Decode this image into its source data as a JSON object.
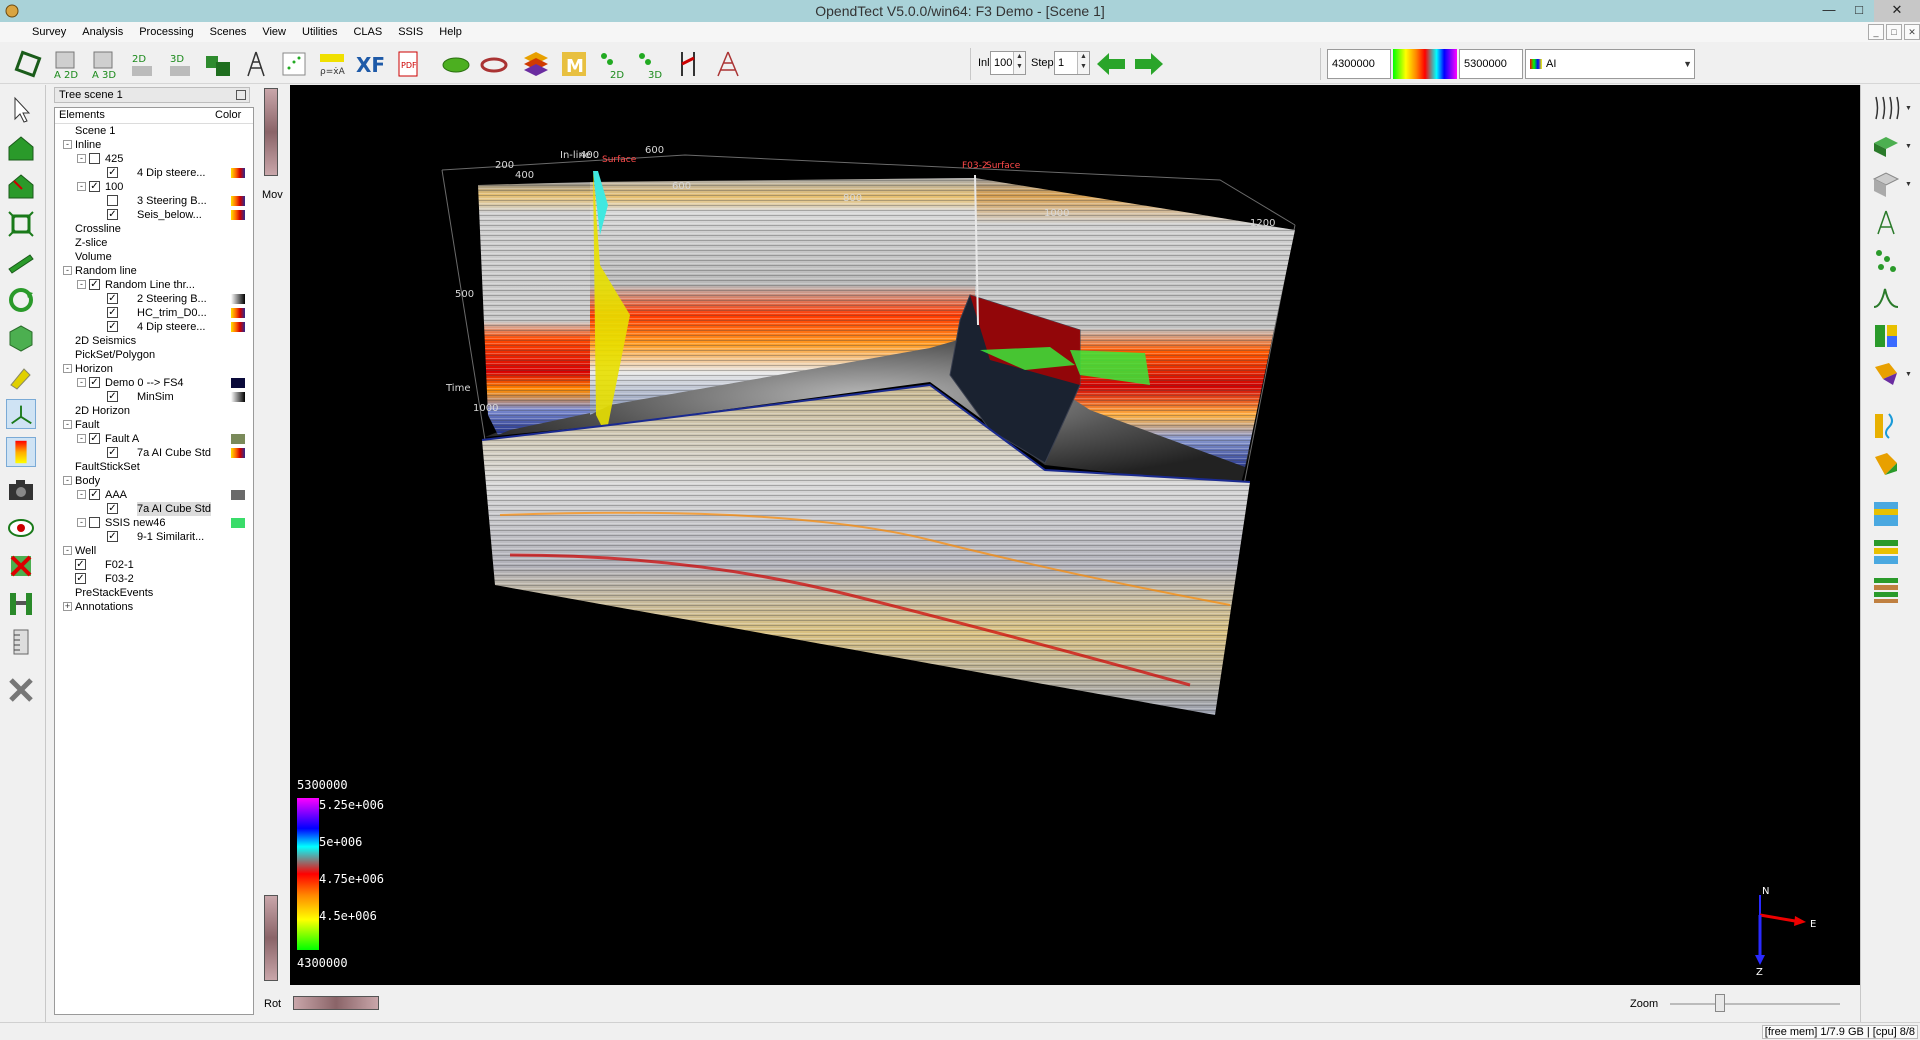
{
  "window": {
    "title": "OpendTect V5.0.0/win64: F3 Demo - [Scene 1]"
  },
  "menu": [
    "Survey",
    "Analysis",
    "Processing",
    "Scenes",
    "View",
    "Utilities",
    "CLAS",
    "SSIS",
    "Help"
  ],
  "toolbar": {
    "icons": [
      "pick-polygon-icon",
      "attribute-2d-icon",
      "attribute-3d-icon",
      "volume-2d-icon",
      "volume-3d-icon",
      "cubes-icon",
      "well-tie-icon",
      "crossplot-icon",
      "rock-physics-icon",
      "cross-section-icon",
      "pdf-icon",
      "horizon-icon",
      "ring-icon",
      "layers-icon",
      "m-icon",
      "steering-2d-icon",
      "steering-3d-icon",
      "fault-icon",
      "log-tree-icon"
    ],
    "inl_label": "Inl",
    "inl_value": "100",
    "step_label": "Step",
    "step_value": "1",
    "colorbar_min": "4300000",
    "colorbar_max": "5300000",
    "attribute": "AI"
  },
  "tree": {
    "title": "Tree scene 1",
    "header_elements": "Elements",
    "header_color": "Color",
    "nodes": [
      {
        "label": "Scene 1"
      },
      {
        "label": "Inline"
      },
      {
        "label": "425"
      },
      {
        "label": "4 Dip steere..."
      },
      {
        "label": "100"
      },
      {
        "label": "3 Steering B..."
      },
      {
        "label": "Seis_below..."
      },
      {
        "label": "Crossline"
      },
      {
        "label": "Z-slice"
      },
      {
        "label": "Volume"
      },
      {
        "label": "Random line"
      },
      {
        "label": "Random Line thr..."
      },
      {
        "label": "2 Steering B..."
      },
      {
        "label": "HC_trim_D0..."
      },
      {
        "label": "4 Dip steere..."
      },
      {
        "label": "2D Seismics"
      },
      {
        "label": "PickSet/Polygon"
      },
      {
        "label": "Horizon"
      },
      {
        "label": "Demo 0 --> FS4"
      },
      {
        "label": "MinSim"
      },
      {
        "label": "2D Horizon"
      },
      {
        "label": "Fault"
      },
      {
        "label": "Fault A"
      },
      {
        "label": "7a AI Cube Std"
      },
      {
        "label": "FaultStickSet"
      },
      {
        "label": "Body"
      },
      {
        "label": "AAA"
      },
      {
        "label": "7a AI Cube Std"
      },
      {
        "label": "SSIS new46"
      },
      {
        "label": "9-1 Similarit..."
      },
      {
        "label": "Well"
      },
      {
        "label": "F02-1"
      },
      {
        "label": "F03-2"
      },
      {
        "label": "PreStackEvents"
      },
      {
        "label": "Annotations"
      }
    ]
  },
  "side": {
    "mov_label": "Mov",
    "rot_label": "Rot",
    "zoom_label": "Zoom"
  },
  "scene": {
    "inline_labels": [
      "200",
      "In-line",
      "400",
      "600",
      "400",
      "600",
      "800",
      "1000",
      "1200"
    ],
    "time_label": "Time",
    "time_ticks": [
      "500",
      "1000"
    ],
    "surface_labels": [
      "Surface",
      "F03-2",
      "Surface"
    ],
    "colorbar_top": "5300000",
    "colorbar_bottom": "4300000",
    "colorbar_ticks": [
      "5.25e+006",
      "5e+006",
      "4.75e+006",
      "4.5e+006"
    ],
    "axes": {
      "n": "N",
      "e": "E",
      "z": "Z"
    }
  },
  "status": {
    "text": "[free mem] 1/7.9 GB | [cpu] 8/8"
  },
  "colors": {
    "titlebar": "#a9d2d8",
    "viewport": "#000000"
  }
}
